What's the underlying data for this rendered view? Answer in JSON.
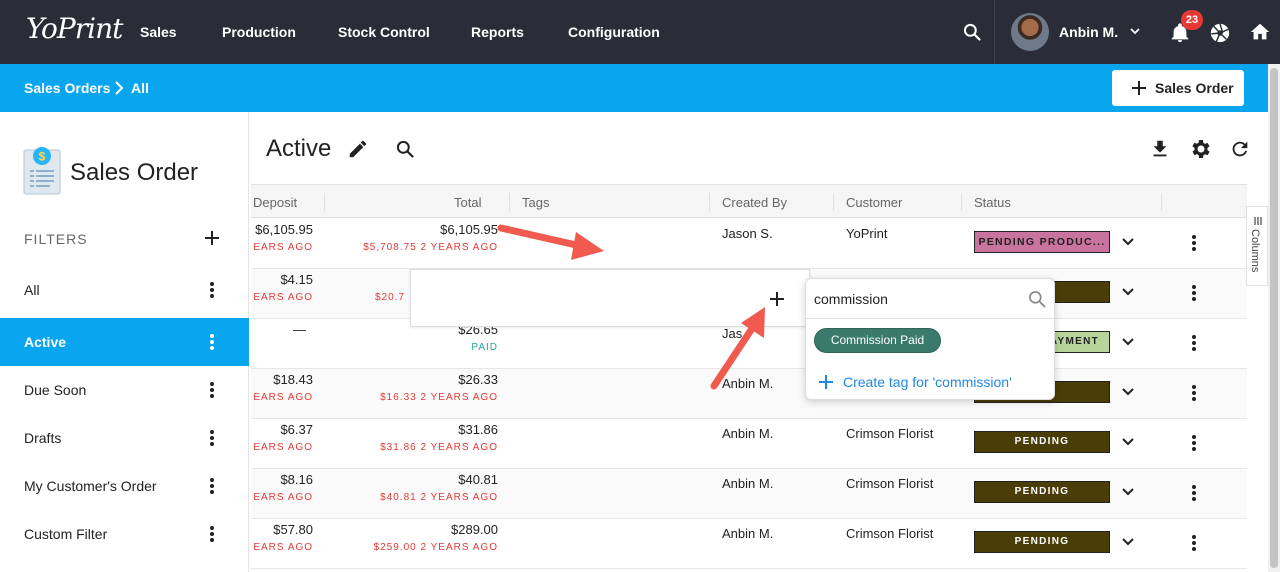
{
  "app": {
    "logo": "YoPrint"
  },
  "nav": {
    "items": [
      "Sales",
      "Production",
      "Stock Control",
      "Reports",
      "Configuration"
    ],
    "user_name": "Anbin M.",
    "notification_count": "23"
  },
  "breadcrumb": {
    "root": "Sales Orders",
    "current": "All"
  },
  "new_order_button": "Sales Order",
  "sidebar": {
    "title": "Sales Order",
    "filters_label": "FILTERS",
    "filters": [
      "All",
      "Active",
      "Due Soon",
      "Drafts",
      "My Customer's Order",
      "Custom Filter"
    ],
    "active_filter": "Active"
  },
  "main": {
    "title": "Active"
  },
  "table": {
    "columns": [
      "Deposit",
      "Total",
      "Tags",
      "Created By",
      "Customer",
      "Status"
    ],
    "rows": [
      {
        "deposit": "$6,105.95",
        "deposit_sub": "EARS AGO",
        "total": "$6,105.95",
        "total_sub": "$5,708.75 2 YEARS AGO",
        "created_by": "Jason S.",
        "customer": "YoPrint",
        "status": "PENDING PRODUC..."
      },
      {
        "deposit": "$4.15",
        "deposit_sub": "EARS AGO",
        "total": "",
        "total_sub": "$20.7",
        "created_by": "",
        "customer": "",
        "status": ""
      },
      {
        "deposit": "—",
        "deposit_sub": "",
        "total": "$26.65",
        "total_sub": "PAID",
        "created_by": "Jas",
        "customer": "",
        "status": "AYMENT"
      },
      {
        "deposit": "$18.43",
        "deposit_sub": "EARS AGO",
        "total": "$26.33",
        "total_sub": "$16.33 2 YEARS AGO",
        "created_by": "Anbin M.",
        "customer": "",
        "status": ""
      },
      {
        "deposit": "$6.37",
        "deposit_sub": "EARS AGO",
        "total": "$31.86",
        "total_sub": "$31.86 2 YEARS AGO",
        "created_by": "Anbin M.",
        "customer": "Crimson Florist",
        "status": "PENDING"
      },
      {
        "deposit": "$8.16",
        "deposit_sub": "EARS AGO",
        "total": "$40.81",
        "total_sub": "$40.81 2 YEARS AGO",
        "created_by": "Anbin M.",
        "customer": "Crimson Florist",
        "status": "PENDING"
      },
      {
        "deposit": "$57.80",
        "deposit_sub": "EARS AGO",
        "total": "$289.00",
        "total_sub": "$259.00 2 YEARS AGO",
        "created_by": "Anbin M.",
        "customer": "Crimson Florist",
        "status": "PENDING"
      }
    ]
  },
  "columns_tab": "Columns",
  "tag_dropdown": {
    "search_value": "commission",
    "option": "Commission Paid",
    "create_label": "Create tag for 'commission'"
  },
  "colors": {
    "nav_bg": "#2a2d37",
    "accent_blue": "#0aa5ef",
    "status_pending": "#4a3d07",
    "status_production": "#c9739f",
    "status_payment": "#b7d59b",
    "chip_green": "#3a7a6c",
    "link_blue": "#1e88e5",
    "arrow": "#f05a4f",
    "overdue_red": "#e53935",
    "paid_teal": "#26a69a"
  }
}
